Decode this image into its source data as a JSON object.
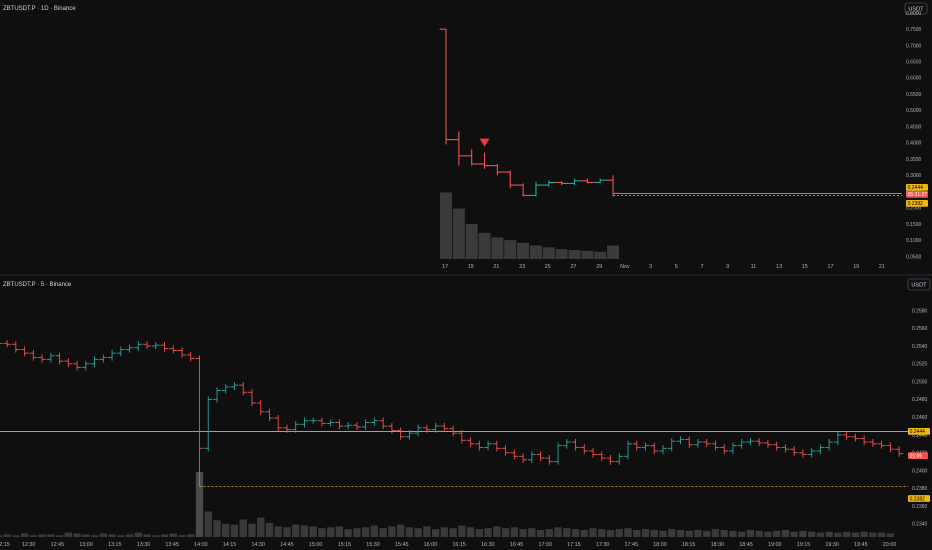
{
  "colors": {
    "background": "#0f0f0f",
    "up": "#26a69a",
    "down": "#ef5350",
    "volume": "#3a3a3a",
    "highlight_volume": "#4a4a4a",
    "priceline": "#f0b90b",
    "label_text": "#000000",
    "sell_marker": "#ef3b3b",
    "separator": "#2a2a3a"
  },
  "chart_data": [
    {
      "type": "ohlc",
      "title": "ZBTUSDT.P · 1D · Binance",
      "currency": "USDT",
      "y_ticks": [
        "0.8000",
        "0.7500",
        "0.7000",
        "0.6500",
        "0.6000",
        "0.5500",
        "0.5000",
        "0.4500",
        "0.4000",
        "0.3500",
        "0.3000",
        "0.2500",
        "0.2000",
        "0.1500",
        "0.1000",
        "0.0500"
      ],
      "ylim": [
        0.03,
        0.84
      ],
      "x_tick_labels": [
        "17",
        "19",
        "21",
        "23",
        "25",
        "27",
        "29",
        "Nov",
        "3",
        "5",
        "7",
        "9",
        "11",
        "13",
        "15",
        "17",
        "19",
        "21"
      ],
      "x_range_days": [
        0,
        35
      ],
      "candles": [
        {
          "o": 0.75,
          "h": 0.75,
          "l": 0.395,
          "c": 0.41
        },
        {
          "o": 0.41,
          "h": 0.435,
          "l": 0.33,
          "c": 0.36
        },
        {
          "o": 0.36,
          "h": 0.38,
          "l": 0.33,
          "c": 0.335
        },
        {
          "o": 0.335,
          "h": 0.37,
          "l": 0.32,
          "c": 0.33
        },
        {
          "o": 0.33,
          "h": 0.335,
          "l": 0.3,
          "c": 0.31
        },
        {
          "o": 0.31,
          "h": 0.315,
          "l": 0.26,
          "c": 0.27
        },
        {
          "o": 0.27,
          "h": 0.275,
          "l": 0.235,
          "c": 0.2382
        },
        {
          "o": 0.2382,
          "h": 0.28,
          "l": 0.235,
          "c": 0.27
        },
        {
          "o": 0.27,
          "h": 0.285,
          "l": 0.265,
          "c": 0.278
        },
        {
          "o": 0.278,
          "h": 0.282,
          "l": 0.27,
          "c": 0.275
        },
        {
          "o": 0.275,
          "h": 0.29,
          "l": 0.27,
          "c": 0.283
        },
        {
          "o": 0.283,
          "h": 0.29,
          "l": 0.275,
          "c": 0.278
        },
        {
          "o": 0.278,
          "h": 0.29,
          "l": 0.276,
          "c": 0.285
        },
        {
          "o": 0.285,
          "h": 0.3,
          "l": 0.235,
          "c": 0.2444
        }
      ],
      "volume": [
        0.74,
        0.56,
        0.39,
        0.29,
        0.24,
        0.21,
        0.18,
        0.15,
        0.13,
        0.11,
        0.1,
        0.09,
        0.08,
        0.15
      ],
      "sell_marker_index": 3,
      "price_labels": {
        "last": "0.2444",
        "countdown": "05:31:27",
        "low": "0.2382"
      },
      "last_value": 0.2444,
      "low_value": 0.2382
    },
    {
      "type": "ohlc",
      "title": "ZBTUSDT.P · 5 · Binance",
      "currency": "USDT",
      "y_ticks": [
        "0.2580",
        "0.2560",
        "0.2540",
        "0.2520",
        "0.2500",
        "0.2480",
        "0.2460",
        "0.2440",
        "0.2420",
        "0.2400",
        "0.2380",
        "0.2360",
        "0.2340"
      ],
      "ylim": [
        0.2332,
        0.2594
      ],
      "x_tick_labels": [
        "12:15",
        "12:30",
        "12:45",
        "13:00",
        "13:15",
        "13:30",
        "13:45",
        "14:00",
        "14:15",
        "14:30",
        "14:45",
        "15:00",
        "15:15",
        "15:30",
        "15:45",
        "16:00",
        "16:15",
        "16:30",
        "16:45",
        "17:00",
        "17:15",
        "17:30",
        "17:45",
        "18:00",
        "18:15",
        "18:30",
        "18:45",
        "19:00",
        "19:15",
        "19:30",
        "19:45",
        "20:00"
      ],
      "first_tick_minutes": 735,
      "tick_step_minutes": 15,
      "start_minutes": 725,
      "end_minutes": 1205,
      "closes": [
        0.254,
        0.2545,
        0.2543,
        0.2542,
        0.2536,
        0.2532,
        0.2527,
        0.2525,
        0.2529,
        0.2523,
        0.252,
        0.2516,
        0.252,
        0.2525,
        0.2527,
        0.2532,
        0.2536,
        0.2538,
        0.2542,
        0.254,
        0.2541,
        0.2537,
        0.2535,
        0.253,
        0.2526,
        0.2425,
        0.248,
        0.249,
        0.2494,
        0.2496,
        0.2488,
        0.2476,
        0.2466,
        0.2459,
        0.2448,
        0.2446,
        0.2452,
        0.2456,
        0.2456,
        0.2453,
        0.2454,
        0.245,
        0.2451,
        0.2449,
        0.2454,
        0.2456,
        0.245,
        0.2445,
        0.2438,
        0.2442,
        0.2448,
        0.2446,
        0.245,
        0.2447,
        0.2442,
        0.2434,
        0.243,
        0.2426,
        0.243,
        0.2425,
        0.242,
        0.2416,
        0.2412,
        0.2418,
        0.2414,
        0.241,
        0.2428,
        0.2432,
        0.2426,
        0.2422,
        0.2418,
        0.2414,
        0.241,
        0.2416,
        0.243,
        0.2426,
        0.2428,
        0.2422,
        0.2425,
        0.2433,
        0.2435,
        0.2429,
        0.2432,
        0.243,
        0.2426,
        0.2422,
        0.2428,
        0.2432,
        0.2433,
        0.2431,
        0.2429,
        0.2426,
        0.2424,
        0.242,
        0.2418,
        0.2422,
        0.2426,
        0.2432,
        0.244,
        0.2438,
        0.2436,
        0.2432,
        0.243,
        0.2428,
        0.2424,
        0.2419
      ],
      "volume": [
        0.02,
        0.03,
        0.02,
        0.03,
        0.02,
        0.04,
        0.02,
        0.03,
        0.03,
        0.02,
        0.05,
        0.04,
        0.03,
        0.02,
        0.04,
        0.03,
        0.02,
        0.03,
        0.05,
        0.03,
        0.02,
        0.03,
        0.04,
        0.02,
        0.03,
        0.74,
        0.29,
        0.19,
        0.15,
        0.14,
        0.2,
        0.15,
        0.22,
        0.16,
        0.12,
        0.11,
        0.14,
        0.13,
        0.12,
        0.1,
        0.11,
        0.12,
        0.09,
        0.1,
        0.11,
        0.13,
        0.1,
        0.12,
        0.14,
        0.11,
        0.1,
        0.12,
        0.09,
        0.11,
        0.1,
        0.13,
        0.11,
        0.09,
        0.1,
        0.12,
        0.1,
        0.11,
        0.09,
        0.1,
        0.08,
        0.09,
        0.11,
        0.1,
        0.09,
        0.08,
        0.1,
        0.09,
        0.08,
        0.09,
        0.1,
        0.08,
        0.09,
        0.08,
        0.07,
        0.09,
        0.08,
        0.07,
        0.08,
        0.07,
        0.09,
        0.08,
        0.07,
        0.06,
        0.08,
        0.07,
        0.06,
        0.07,
        0.08,
        0.06,
        0.07,
        0.06,
        0.05,
        0.06,
        0.05,
        0.06,
        0.05,
        0.06,
        0.05,
        0.05,
        0.04
      ],
      "price_labels": {
        "last": "0.2444",
        "countdown": "01:06",
        "low": "0.2382"
      },
      "last_value": 0.2444,
      "low_value": 0.2382
    }
  ]
}
